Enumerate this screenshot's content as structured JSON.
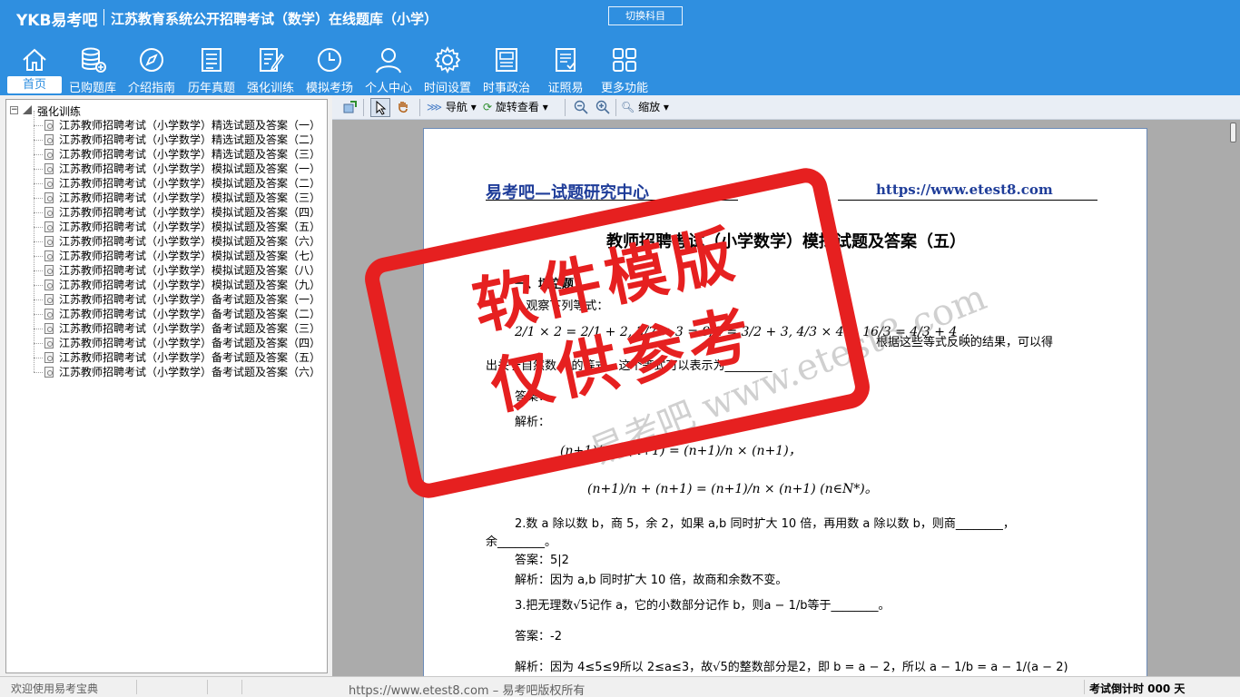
{
  "header": {
    "logo": "YKB易考吧",
    "title": "江苏教育系统公开招聘考试（数学）在线题库（小学）",
    "switch_button": "切换科目"
  },
  "nav": [
    {
      "label": "首页",
      "icon": "home-icon",
      "active": true
    },
    {
      "label": "已购题库",
      "icon": "database-icon"
    },
    {
      "label": "介绍指南",
      "icon": "compass-icon"
    },
    {
      "label": "历年真题",
      "icon": "list-document-icon"
    },
    {
      "label": "强化训练",
      "icon": "edit-document-icon"
    },
    {
      "label": "模拟考场",
      "icon": "clock-icon"
    },
    {
      "label": "个人中心",
      "icon": "user-icon"
    },
    {
      "label": "时间设置",
      "icon": "gear-icon"
    },
    {
      "label": "时事政治",
      "icon": "newspaper-icon"
    },
    {
      "label": "证照易",
      "icon": "certificate-icon"
    },
    {
      "label": "更多功能",
      "icon": "grid-icon"
    }
  ],
  "tree": {
    "root": "强化训练",
    "items": [
      "江苏教师招聘考试（小学数学）精选试题及答案（一）",
      "江苏教师招聘考试（小学数学）精选试题及答案（二）",
      "江苏教师招聘考试（小学数学）精选试题及答案（三）",
      "江苏教师招聘考试（小学数学）模拟试题及答案（一）",
      "江苏教师招聘考试（小学数学）模拟试题及答案（二）",
      "江苏教师招聘考试（小学数学）模拟试题及答案（三）",
      "江苏教师招聘考试（小学数学）模拟试题及答案（四）",
      "江苏教师招聘考试（小学数学）模拟试题及答案（五）",
      "江苏教师招聘考试（小学数学）模拟试题及答案（六）",
      "江苏教师招聘考试（小学数学）模拟试题及答案（七）",
      "江苏教师招聘考试（小学数学）模拟试题及答案（八）",
      "江苏教师招聘考试（小学数学）模拟试题及答案（九）",
      "江苏教师招聘考试（小学数学）备考试题及答案（一）",
      "江苏教师招聘考试（小学数学）备考试题及答案（二）",
      "江苏教师招聘考试（小学数学）备考试题及答案（三）",
      "江苏教师招聘考试（小学数学）备考试题及答案（四）",
      "江苏教师招聘考试（小学数学）备考试题及答案（五）",
      "江苏教师招聘考试（小学数学）备考试题及答案（六）"
    ]
  },
  "toolbar": {
    "nav_label": "导航",
    "rotate_label": "旋转查看",
    "zoom_label": "缩放"
  },
  "document": {
    "site_name": "易考吧—试题研究中心",
    "site_url": "https://www.etest8.com",
    "title": "教师招聘考试（小学数学）模拟试题及答案（五）",
    "section": "一、填空题",
    "q1_line1": "1.观察下列等式：",
    "q1_formula": "2/1 × 2 = 2/1 + 2,  3/2 × 3 = 9/2 = 3/2 + 3,  4/3 × 4 = 16/3 = 4/3 + 4 …",
    "q1_line2": "根据这些等式反映的结果，可以得",
    "q1_line3": "出关于自然数 n 的等式，这个等式可以表示为________",
    "q1_answer_label": "答案：",
    "q1_analysis_label": "解析：",
    "q1_formula2": "(n+1)/n + (n+1) = (n+1)/n × (n+1)，",
    "q1_formula3": "(n+1)/n + (n+1) = (n+1)/n × (n+1) (n∈N*)。",
    "q2": "2.数 a 除以数 b，商 5，余 2，如果 a,b 同时扩大 10 倍，再用数 a 除以数 b，则商________，",
    "q2_cont": "余________。",
    "q2_answer": "答案：5|2",
    "q2_analysis": "解析：因为 a,b 同时扩大 10 倍，故商和余数不变。",
    "q3": "3.把无理数√5记作 a，它的小数部分记作 b，则a − 1/b等于________。",
    "q3_answer": "答案：-2",
    "q3_analysis": "解析：因为 4≤5≤9所以 2≤a≤3，故√5的整数部分是2，即 b = a − 2，所以 a − 1/b = a − 1/(a − 2)"
  },
  "watermark": {
    "stamp_line1": "软件模版",
    "stamp_line2": "仅供参考",
    "site_text": "易考吧 www.etest8.com"
  },
  "statusbar": {
    "welcome": "欢迎使用易考宝典",
    "copyright": "https://www.etest8.com – 易考吧版权所有",
    "countdown": "考试倒计时 000 天"
  },
  "colors": {
    "header_blue": "#2f8fe0",
    "stamp_red": "#e62020",
    "link_blue": "#1f3d99"
  }
}
